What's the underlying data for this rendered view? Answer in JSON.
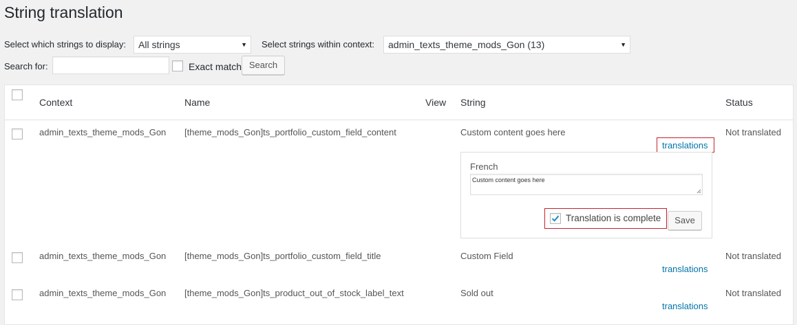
{
  "page": {
    "title": "String translation"
  },
  "filters": {
    "display_label": "Select which strings to display:",
    "display_value": "All strings",
    "context_label": "Select strings within context:",
    "context_value": "admin_texts_theme_mods_Gon (13)",
    "search_label": "Search for:",
    "search_value": "",
    "exact_match_label": "Exact match",
    "search_button": "Search"
  },
  "table": {
    "columns": {
      "context": "Context",
      "name": "Name",
      "view": "View",
      "string": "String",
      "status": "Status"
    },
    "rows": [
      {
        "context": "admin_texts_theme_mods_Gon",
        "name": "[theme_mods_Gon]ts_portfolio_custom_field_content",
        "string": "Custom content goes here",
        "translations_link": "translations",
        "status": "Not translated"
      },
      {
        "context": "admin_texts_theme_mods_Gon",
        "name": "[theme_mods_Gon]ts_portfolio_custom_field_title",
        "string": "Custom Field",
        "translations_link": "translations",
        "status": "Not translated"
      },
      {
        "context": "admin_texts_theme_mods_Gon",
        "name": "[theme_mods_Gon]ts_product_out_of_stock_label_text",
        "string": "Sold out",
        "translations_link": "translations",
        "status": "Not translated"
      }
    ]
  },
  "translation_panel": {
    "language": "French",
    "value": "Custom content goes here",
    "complete_label": "Translation is complete",
    "complete_checked": true,
    "save_button": "Save"
  },
  "colors": {
    "link": "#0073aa",
    "highlight": "#c4202e",
    "checkmark": "#1e8cbe"
  }
}
